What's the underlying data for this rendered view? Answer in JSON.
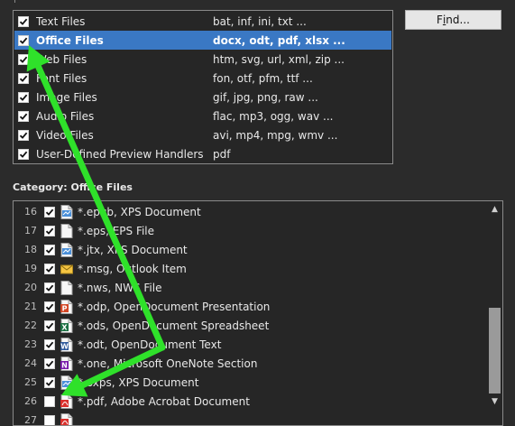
{
  "find_button": {
    "label_prefix": "F",
    "label_underline": "i",
    "label_suffix": "nd..."
  },
  "categories": [
    {
      "label": "Text Files",
      "extensions": "bat, inf, ini, txt ...",
      "checked": true,
      "selected": false
    },
    {
      "label": "Office Files",
      "extensions": "docx, odt, pdf, xlsx ...",
      "checked": true,
      "selected": true
    },
    {
      "label": "Web Files",
      "extensions": "htm, svg, url, xml, zip ...",
      "checked": true,
      "selected": false
    },
    {
      "label": "Font Files",
      "extensions": "fon, otf, pfm, ttf ...",
      "checked": true,
      "selected": false
    },
    {
      "label": "Image Files",
      "extensions": "gif, jpg, png, raw ...",
      "checked": true,
      "selected": false
    },
    {
      "label": "Audio Files",
      "extensions": "flac, mp3, ogg, wav ...",
      "checked": true,
      "selected": false
    },
    {
      "label": "Video Files",
      "extensions": "avi, mp4, mpg, wmv ...",
      "checked": true,
      "selected": false
    },
    {
      "label": "User-Defined Preview Handlers",
      "extensions": "pdf",
      "checked": true,
      "selected": false
    }
  ],
  "section_label": "Category: Office Files",
  "extension_rows": [
    {
      "num": "16",
      "text": "*.epub, XPS Document",
      "checked": true,
      "icon": "xps-document-icon",
      "color": "#4a8fd8"
    },
    {
      "num": "17",
      "text": "*.eps, EPS File",
      "checked": true,
      "icon": "blank-file-icon",
      "color": "#f2f2f2"
    },
    {
      "num": "18",
      "text": "*.jtx, XPS Document",
      "checked": true,
      "icon": "xps-document-icon",
      "color": "#4a8fd8"
    },
    {
      "num": "19",
      "text": "*.msg, Outlook Item",
      "checked": true,
      "icon": "outlook-mail-icon",
      "color": "#f5c542"
    },
    {
      "num": "20",
      "text": "*.nws, NWS File",
      "checked": true,
      "icon": "blank-file-icon",
      "color": "#f2f2f2"
    },
    {
      "num": "21",
      "text": "*.odp, OpenDocument Presentation",
      "checked": true,
      "icon": "powerpoint-icon",
      "color": "#d24726"
    },
    {
      "num": "22",
      "text": "*.ods, OpenDocument Spreadsheet",
      "checked": true,
      "icon": "excel-icon",
      "color": "#1e7145"
    },
    {
      "num": "23",
      "text": "*.odt, OpenDocument Text",
      "checked": true,
      "icon": "word-icon",
      "color": "#2b579a"
    },
    {
      "num": "24",
      "text": "*.one, Microsoft OneNote Section",
      "checked": true,
      "icon": "onenote-icon",
      "color": "#7719aa"
    },
    {
      "num": "25",
      "text": "*.oxps, XPS Document",
      "checked": true,
      "icon": "xps-document-icon",
      "color": "#4a8fd8"
    },
    {
      "num": "26",
      "text": "*.pdf, Adobe Acrobat Document",
      "checked": false,
      "icon": "pdf-icon",
      "color": "#d9302c"
    },
    {
      "num": "27",
      "text": "",
      "checked": false,
      "icon": "pdf-icon",
      "color": "#d9302c"
    }
  ],
  "colors": {
    "arrow": "#2fe12a",
    "selection": "#3a78c4"
  }
}
